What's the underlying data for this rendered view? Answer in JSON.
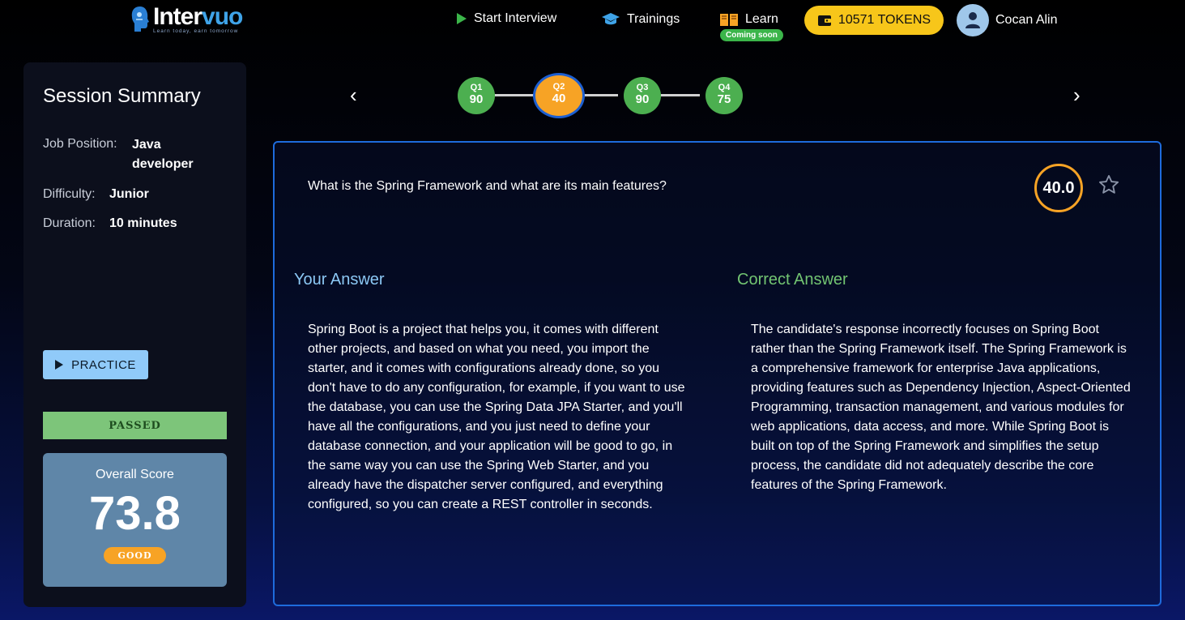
{
  "brand": {
    "name_prefix": "Inter",
    "name_suffix": "vuo",
    "tagline": "Learn today, earn tomorrow"
  },
  "nav": {
    "start_interview": "Start Interview",
    "trainings": "Trainings",
    "learn": "Learn",
    "learn_badge": "Coming soon",
    "tokens": "10571 TOKENS",
    "user_name": "Cocan Alin"
  },
  "sidebar": {
    "title": "Session Summary",
    "job_position_label": "Job Position:",
    "job_position_value": "Java developer",
    "difficulty_label": "Difficulty:",
    "difficulty_value": "Junior",
    "duration_label": "Duration:",
    "duration_value": "10 minutes",
    "practice_label": "PRACTICE",
    "status": "PASSED",
    "overall_score_label": "Overall Score",
    "overall_score_value": "73.8",
    "overall_score_rating": "GOOD"
  },
  "stepper": {
    "questions": [
      {
        "label": "Q1",
        "score": "90",
        "color": "#4caf50"
      },
      {
        "label": "Q2",
        "score": "40",
        "color": "#f7a325",
        "active": true
      },
      {
        "label": "Q3",
        "score": "90",
        "color": "#4caf50"
      },
      {
        "label": "Q4",
        "score": "75",
        "color": "#4caf50"
      }
    ]
  },
  "question": {
    "text": "What is the Spring Framework and what are its main features?",
    "score": "40.0",
    "your_answer_title": "Your Answer",
    "your_answer": "Spring Boot is a project that helps you, it comes with different other projects, and based on what you need, you import the starter, and it comes with configurations already done, so you don't have to do any configuration, for example, if you want to use the database, you can use the Spring Data JPA Starter, and you'll have all the configurations, and you just need to define your database connection, and your application will be good to go, in the same way you can use the Spring Web Starter, and you already have the dispatcher server configured, and everything configured, so you can create a REST controller in seconds.",
    "correct_answer_title": "Correct Answer",
    "correct_answer": "The candidate's response incorrectly focuses on Spring Boot rather than the Spring Framework itself. The Spring Framework is a comprehensive framework for enterprise Java applications, providing features such as Dependency Injection, Aspect-Oriented Programming, transaction management, and various modules for web applications, data access, and more. While Spring Boot is built on top of the Spring Framework and simplifies the setup process, the candidate did not adequately describe the core features of the Spring Framework."
  },
  "colors": {
    "accent_blue": "#1e6bdc",
    "token_yellow": "#f7c61a",
    "pass_green": "#7dc57a",
    "score_orange": "#f7a325"
  }
}
